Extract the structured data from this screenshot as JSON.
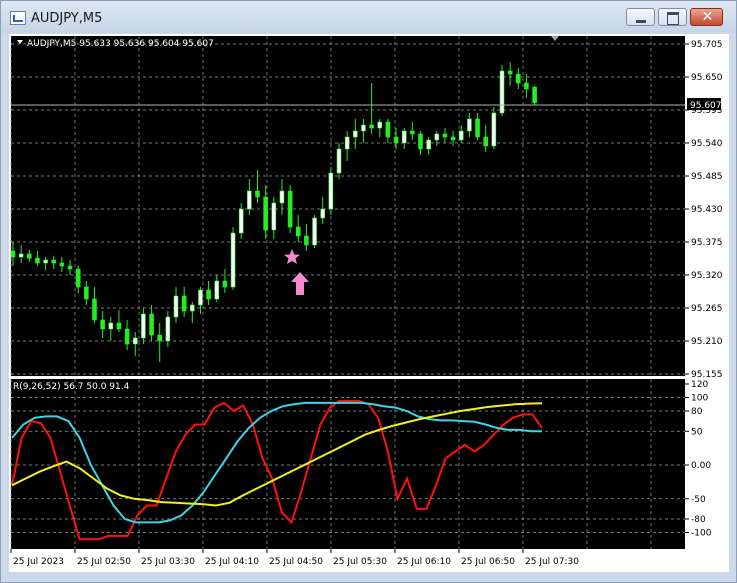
{
  "window": {
    "title": "AUDJPY,M5"
  },
  "chart_header": {
    "symbol_info": "AUDJPY,M5  95.633 95.636 95.604 95.607"
  },
  "indicator_header": {
    "label": "R(9,26,52) 56.7 50.0 91.4"
  },
  "price_axis": {
    "ticks": [
      "95.705",
      "95.650",
      "95.595",
      "95.540",
      "95.485",
      "95.430",
      "95.375",
      "95.320",
      "95.265",
      "95.210",
      "95.155"
    ],
    "current_price": "95.607"
  },
  "indicator_axis": {
    "ticks": [
      "120",
      "100",
      "80",
      "50",
      "0.00",
      "-50",
      "-80",
      "-100"
    ]
  },
  "time_axis": {
    "ticks": [
      "25 Jul 2023",
      "25 Jul 02:50",
      "25 Jul 03:30",
      "25 Jul 04:10",
      "25 Jul 04:50",
      "25 Jul 05:30",
      "25 Jul 06:10",
      "25 Jul 06:50",
      "25 Jul 07:30"
    ]
  },
  "colors": {
    "background": "#000000",
    "grid": "#a0a0a0",
    "bull": "#ffffff",
    "bear": "#22ee22",
    "red_line": "#ff1010",
    "cyan_line": "#3ad7e8",
    "yellow_line": "#f2f21a",
    "marker": "#f68ad1"
  },
  "markers": {
    "star_icon": "star-icon",
    "arrow_icon": "up-arrow-icon"
  },
  "chart_data": [
    {
      "type": "candlestick",
      "ylim": [
        95.155,
        95.705
      ],
      "ohlc": [
        [
          95.36,
          95.375,
          95.335,
          95.35
        ],
        [
          95.35,
          95.37,
          95.34,
          95.355
        ],
        [
          95.355,
          95.362,
          95.342,
          95.348
        ],
        [
          95.348,
          95.36,
          95.335,
          95.34
        ],
        [
          95.34,
          95.35,
          95.328,
          95.345
        ],
        [
          95.345,
          95.352,
          95.33,
          95.34
        ],
        [
          95.34,
          95.35,
          95.325,
          95.335
        ],
        [
          95.335,
          95.345,
          95.32,
          95.33
        ],
        [
          95.33,
          95.336,
          95.29,
          95.3
        ],
        [
          95.3,
          95.31,
          95.27,
          95.28
        ],
        [
          95.28,
          95.3,
          95.24,
          95.245
        ],
        [
          95.245,
          95.26,
          95.215,
          95.23
        ],
        [
          95.23,
          95.25,
          95.21,
          95.24
        ],
        [
          95.24,
          95.262,
          95.225,
          95.23
        ],
        [
          95.23,
          95.245,
          95.195,
          95.205
        ],
        [
          95.205,
          95.225,
          95.185,
          95.215
        ],
        [
          95.215,
          95.265,
          95.205,
          95.255
        ],
        [
          95.255,
          95.27,
          95.21,
          95.22
        ],
        [
          95.22,
          95.24,
          95.175,
          95.21
        ],
        [
          95.21,
          95.26,
          95.2,
          95.25
        ],
        [
          95.25,
          95.3,
          95.24,
          95.285
        ],
        [
          95.285,
          95.3,
          95.25,
          95.26
        ],
        [
          95.26,
          95.275,
          95.24,
          95.27
        ],
        [
          95.27,
          95.3,
          95.255,
          95.295
        ],
        [
          95.295,
          95.31,
          95.27,
          95.28
        ],
        [
          95.28,
          95.32,
          95.275,
          95.31
        ],
        [
          95.31,
          95.33,
          95.29,
          95.3
        ],
        [
          95.3,
          95.4,
          95.295,
          95.39
        ],
        [
          95.39,
          95.44,
          95.38,
          95.43
        ],
        [
          95.43,
          95.48,
          95.42,
          95.46
        ],
        [
          95.46,
          95.495,
          95.44,
          95.45
        ],
        [
          95.45,
          95.47,
          95.38,
          95.395
        ],
        [
          95.395,
          95.45,
          95.38,
          95.44
        ],
        [
          95.44,
          95.48,
          95.42,
          95.46
        ],
        [
          95.46,
          95.47,
          95.39,
          95.4
        ],
        [
          95.4,
          95.42,
          95.375,
          95.385
        ],
        [
          95.385,
          95.405,
          95.36,
          95.37
        ],
        [
          95.37,
          95.42,
          95.365,
          95.415
        ],
        [
          95.415,
          95.45,
          95.405,
          95.43
        ],
        [
          95.43,
          95.5,
          95.42,
          95.49
        ],
        [
          95.49,
          95.54,
          95.48,
          95.53
        ],
        [
          95.53,
          95.56,
          95.51,
          95.55
        ],
        [
          95.55,
          95.58,
          95.53,
          95.56
        ],
        [
          95.56,
          95.58,
          95.54,
          95.57
        ],
        [
          95.57,
          95.64,
          95.555,
          95.565
        ],
        [
          95.565,
          95.58,
          95.55,
          95.575
        ],
        [
          95.575,
          95.58,
          95.54,
          95.55
        ],
        [
          95.55,
          95.565,
          95.53,
          95.54
        ],
        [
          95.54,
          95.565,
          95.53,
          95.56
        ],
        [
          95.56,
          95.575,
          95.545,
          95.555
        ],
        [
          95.555,
          95.56,
          95.52,
          95.53
        ],
        [
          95.53,
          95.55,
          95.52,
          95.545
        ],
        [
          95.545,
          95.56,
          95.535,
          95.555
        ],
        [
          95.555,
          95.565,
          95.54,
          95.55
        ],
        [
          95.55,
          95.56,
          95.535,
          95.545
        ],
        [
          95.545,
          95.57,
          95.54,
          95.56
        ],
        [
          95.56,
          95.59,
          95.55,
          95.58
        ],
        [
          95.58,
          95.59,
          95.545,
          95.55
        ],
        [
          95.55,
          95.57,
          95.525,
          95.535
        ],
        [
          95.535,
          95.6,
          95.53,
          95.59
        ],
        [
          95.59,
          95.67,
          95.585,
          95.66
        ],
        [
          95.66,
          95.675,
          95.635,
          95.655
        ],
        [
          95.655,
          95.665,
          95.63,
          95.64
        ],
        [
          95.64,
          95.655,
          95.615,
          95.63
        ],
        [
          95.633,
          95.636,
          95.604,
          95.607
        ]
      ]
    },
    {
      "type": "line",
      "ylim": [
        -120,
        120
      ],
      "series": [
        {
          "values": [
            -30,
            40,
            65,
            62,
            40,
            -10,
            -60,
            -110,
            -110,
            -110,
            -105,
            -105,
            -105,
            -75,
            -60,
            -60,
            -20,
            20,
            45,
            60,
            60,
            85,
            92,
            80,
            88,
            60,
            10,
            -20,
            -70,
            -85,
            -40,
            10,
            60,
            85,
            95,
            95,
            95,
            90,
            70,
            20,
            -50,
            -20,
            -65,
            -65,
            -30,
            10,
            20,
            30,
            20,
            30,
            45,
            60,
            70,
            75,
            75,
            55
          ]
        },
        {
          "values": [
            40,
            60,
            70,
            72,
            72,
            65,
            40,
            0,
            -30,
            -60,
            -80,
            -85,
            -85,
            -85,
            -82,
            -75,
            -60,
            -40,
            -15,
            10,
            35,
            55,
            70,
            80,
            87,
            90,
            92,
            92,
            92,
            92,
            92,
            92,
            90,
            87,
            85,
            80,
            72,
            68,
            66,
            66,
            65,
            64,
            60,
            55,
            52,
            52,
            50,
            50
          ]
        },
        {
          "values": [
            -30,
            -20,
            -10,
            -2,
            5,
            -5,
            -20,
            -35,
            -45,
            -50,
            -52,
            -55,
            -56,
            -57,
            -58,
            -60,
            -56,
            -45,
            -35,
            -25,
            -15,
            -5,
            5,
            15,
            25,
            35,
            45,
            52,
            58,
            63,
            68,
            72,
            76,
            80,
            83,
            86,
            88,
            90,
            91,
            91.4
          ]
        }
      ]
    }
  ]
}
